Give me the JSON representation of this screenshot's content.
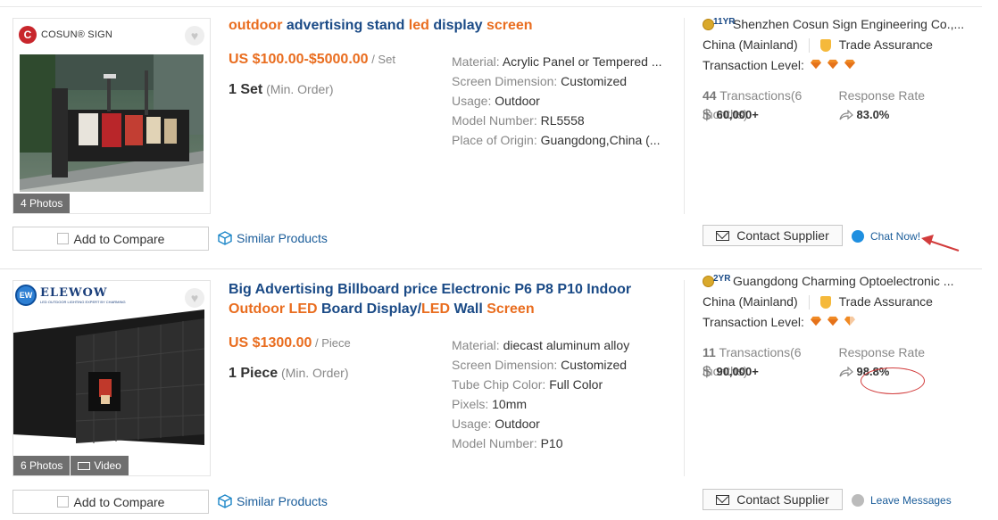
{
  "listings": [
    {
      "logo_text": "COSUN® SIGN",
      "logo_mark": "C",
      "photos_label": "4 Photos",
      "compare_label": "Add to Compare",
      "similar_label": "Similar Products",
      "title_parts": [
        {
          "text": "outdoor",
          "tone": "orange"
        },
        {
          "text": " advertising stand ",
          "tone": "blue"
        },
        {
          "text": "led",
          "tone": "orange"
        },
        {
          "text": " display ",
          "tone": "blue"
        },
        {
          "text": "screen",
          "tone": "orange"
        }
      ],
      "price": "US $100.00-$5000.00",
      "price_unit": " / Set",
      "min_order_qty": "1 Set",
      "min_order_label": " (Min. Order)",
      "specs": [
        {
          "k": "Material: ",
          "v": "Acrylic Panel or Tempered ..."
        },
        {
          "k": "Screen Dimension: ",
          "v": "Customized"
        },
        {
          "k": "Usage: ",
          "v": "Outdoor"
        },
        {
          "k": "Model Number: ",
          "v": "RL5558"
        },
        {
          "k": "Place of Origin: ",
          "v": "Guangdong,China (..."
        }
      ],
      "supplier": {
        "years": "11YR",
        "name": "Shenzhen Cosun Sign Engineering Co.,...",
        "country": "China (Mainland)",
        "assurance": "Trade Assurance",
        "transaction_level_label": "Transaction Level:",
        "transaction_level": 3,
        "transactions_count": "44",
        "transactions_label": " Transactions(6 months)",
        "transactions_value": "60,000+",
        "response_rate_label": "Response Rate",
        "response_rate": "83.0%"
      },
      "contact_label": "Contact Supplier",
      "chat_label": "Chat Now!"
    },
    {
      "logo_text": "ELEWOW",
      "logo_sub": "LED OUTDOOR LIGHTING EXPERT BY CHARMING",
      "logo_mark": "EW",
      "photos_label": "6 Photos",
      "video_label": "Video",
      "compare_label": "Add to Compare",
      "similar_label": "Similar Products",
      "title_parts": [
        {
          "text": "Big Advertising Billboard price Electronic P6 P8 P10 Indoor ",
          "tone": "blue"
        },
        {
          "text": "Outdoor",
          "tone": "orange"
        },
        {
          "text": " ",
          "tone": "blue"
        },
        {
          "text": "LED",
          "tone": "orange"
        },
        {
          "text": " Board Display/",
          "tone": "blue"
        },
        {
          "text": "LED",
          "tone": "orange"
        },
        {
          "text": " Wall ",
          "tone": "blue"
        },
        {
          "text": "Screen",
          "tone": "orange"
        }
      ],
      "price": "US $1300.00",
      "price_unit": " / Piece",
      "min_order_qty": "1 Piece",
      "min_order_label": " (Min. Order)",
      "specs": [
        {
          "k": "Material: ",
          "v": "diecast aluminum alloy"
        },
        {
          "k": "Screen Dimension: ",
          "v": "Customized"
        },
        {
          "k": "Tube Chip Color: ",
          "v": "Full Color"
        },
        {
          "k": "Pixels: ",
          "v": "10mm"
        },
        {
          "k": "Usage: ",
          "v": "Outdoor"
        },
        {
          "k": "Model Number: ",
          "v": "P10"
        }
      ],
      "supplier": {
        "years": "2YR",
        "name": "Guangdong Charming Optoelectronic ...",
        "country": "China (Mainland)",
        "assurance": "Trade Assurance",
        "transaction_level_label": "Transaction Level:",
        "transaction_level": 2.5,
        "transactions_count": "11",
        "transactions_label": " Transactions(6 months)",
        "transactions_value": "90,000+",
        "response_rate_label": "Response Rate",
        "response_rate": "98.8%"
      },
      "contact_label": "Contact Supplier",
      "chat_label": "Leave Messages"
    }
  ],
  "colors": {
    "orange": "#e96d1f",
    "blue": "#1a4a86",
    "link": "#1b5d9a",
    "annotation_red": "#d23c3c"
  }
}
